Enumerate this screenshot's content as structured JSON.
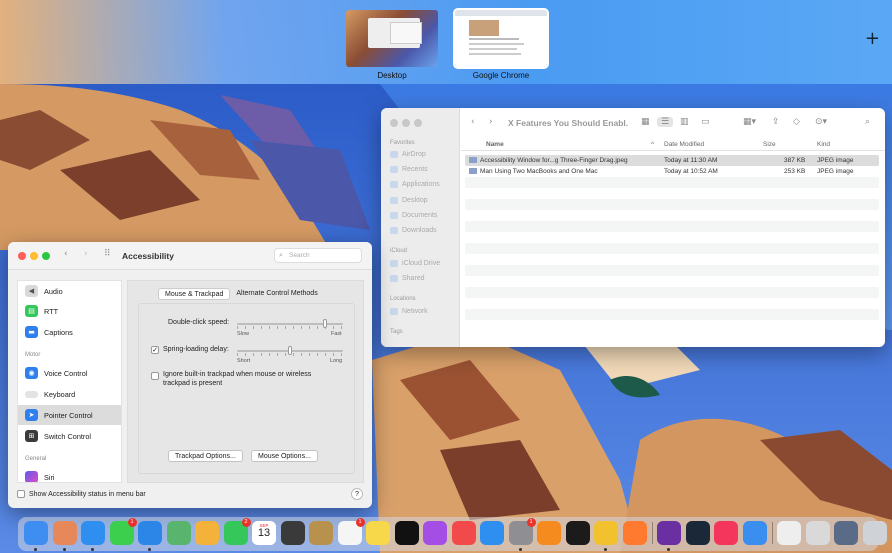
{
  "mission_control": {
    "spaces": [
      {
        "label": "Desktop"
      },
      {
        "label": "Google Chrome"
      }
    ],
    "add_space": "+"
  },
  "finder": {
    "window_title": "X Features You Should Enabl...",
    "sidebar": {
      "favorites_header": "Favorites",
      "favorites": [
        "AirDrop",
        "Recents",
        "Applications",
        "Desktop",
        "Documents",
        "Downloads"
      ],
      "icloud_header": "iCloud",
      "icloud": [
        "iCloud Drive",
        "Shared"
      ],
      "locations_header": "Locations",
      "locations": [
        "Network"
      ],
      "tags_header": "Tags"
    },
    "columns": {
      "name": "Name",
      "date": "Date Modified",
      "size": "Size",
      "kind": "Kind"
    },
    "files": [
      {
        "name": "Accessibility Window for...g Three-Finger Drag.jpeg",
        "date": "Today at 11:30 AM",
        "size": "387 KB",
        "kind": "JPEG image"
      },
      {
        "name": "Man Using Two MacBooks and One Mac",
        "date": "Today at 10:52 AM",
        "size": "253 KB",
        "kind": "JPEG image"
      }
    ]
  },
  "accessibility": {
    "title": "Accessibility",
    "search_placeholder": "Search",
    "sidebar_items": [
      {
        "label": "Audio",
        "icon": "speaker-icon",
        "color": "#8e8e93"
      },
      {
        "label": "RTT",
        "icon": "rtt-icon",
        "color": "#34c759"
      },
      {
        "label": "Captions",
        "icon": "captions-icon",
        "color": "#2f80ed"
      },
      {
        "label": "Voice Control",
        "icon": "voice-control-icon",
        "color": "#2f80ed"
      },
      {
        "label": "Keyboard",
        "icon": "keyboard-icon",
        "color": "#d9d9d9"
      },
      {
        "label": "Pointer Control",
        "icon": "pointer-icon",
        "color": "#2f80ed"
      },
      {
        "label": "Switch Control",
        "icon": "switch-control-icon",
        "color": "#3a3a3c"
      },
      {
        "label": "Siri",
        "icon": "siri-icon",
        "color": "#7a4fd6"
      }
    ],
    "section_motor": "Motor",
    "section_general": "General",
    "tabs": [
      "Mouse & Trackpad",
      "Alternate Control Methods"
    ],
    "double_click_label": "Double-click speed:",
    "double_click_min": "Slow",
    "double_click_max": "Fast",
    "double_click_value": 0.85,
    "spring_loading_label": "Spring-loading delay:",
    "spring_loading_checked": true,
    "spring_min": "Short",
    "spring_max": "Long",
    "spring_value": 0.5,
    "ignore_trackpad_label_1": "Ignore built-in trackpad when mouse or wireless",
    "ignore_trackpad_label_2": "trackpad is present",
    "ignore_trackpad_checked": false,
    "trackpad_options_button": "Trackpad Options...",
    "mouse_options_button": "Mouse Options...",
    "show_status_label": "Show Accessibility status in menu bar",
    "help": "?"
  },
  "dock": {
    "calendar_month": "SEP",
    "calendar_day": "13",
    "apps": [
      {
        "name": "finder-icon",
        "color": "#3d8ef0"
      },
      {
        "name": "launchpad-icon",
        "color": "#e7885b"
      },
      {
        "name": "safari-icon",
        "color": "#2f8ff0"
      },
      {
        "name": "messages-icon",
        "color": "#3ccf4e",
        "badge": "1"
      },
      {
        "name": "mail-icon",
        "color": "#2b86e8"
      },
      {
        "name": "maps-icon",
        "color": "#59b56d"
      },
      {
        "name": "photos-icon",
        "color": "#f4b23a"
      },
      {
        "name": "facetime-icon",
        "color": "#35c75a",
        "badge": "2"
      },
      {
        "name": "calendar-icon",
        "color": "#ffffff"
      },
      {
        "name": "calculator-icon",
        "color": "#3a3a3a"
      },
      {
        "name": "notebook-icon",
        "color": "#b8924d"
      },
      {
        "name": "reminders-icon",
        "color": "#f5f5f5",
        "badge": "1"
      },
      {
        "name": "notes-icon",
        "color": "#f7d84a"
      },
      {
        "name": "apple-tv-icon",
        "color": "#111111"
      },
      {
        "name": "podcasts-icon",
        "color": "#a44ee6"
      },
      {
        "name": "news-icon",
        "color": "#f24a4a"
      },
      {
        "name": "app-store-icon",
        "color": "#2f8ff0"
      },
      {
        "name": "system-preferences-icon",
        "color": "#8e8e93",
        "badge": "1"
      },
      {
        "name": "vlc-icon",
        "color": "#f58a1f"
      },
      {
        "name": "activity-monitor-icon",
        "color": "#1b1b1b"
      },
      {
        "name": "chrome-icon",
        "color": "#f2c12e"
      },
      {
        "name": "firefox-icon",
        "color": "#ff7a2e"
      },
      {
        "name": "tor-icon",
        "color": "#6a2fa0"
      },
      {
        "name": "steam-icon",
        "color": "#1b2838"
      },
      {
        "name": "music-icon",
        "color": "#f5365c"
      },
      {
        "name": "testflight-icon",
        "color": "#3a8ef0"
      },
      {
        "name": "preview-icon",
        "color": "#eeeeee"
      },
      {
        "name": "scanner-icon",
        "color": "#d9d9d9"
      },
      {
        "name": "screen-capture-icon",
        "color": "#5a6b88"
      },
      {
        "name": "trash-icon",
        "color": "#cfd3d8"
      }
    ]
  }
}
